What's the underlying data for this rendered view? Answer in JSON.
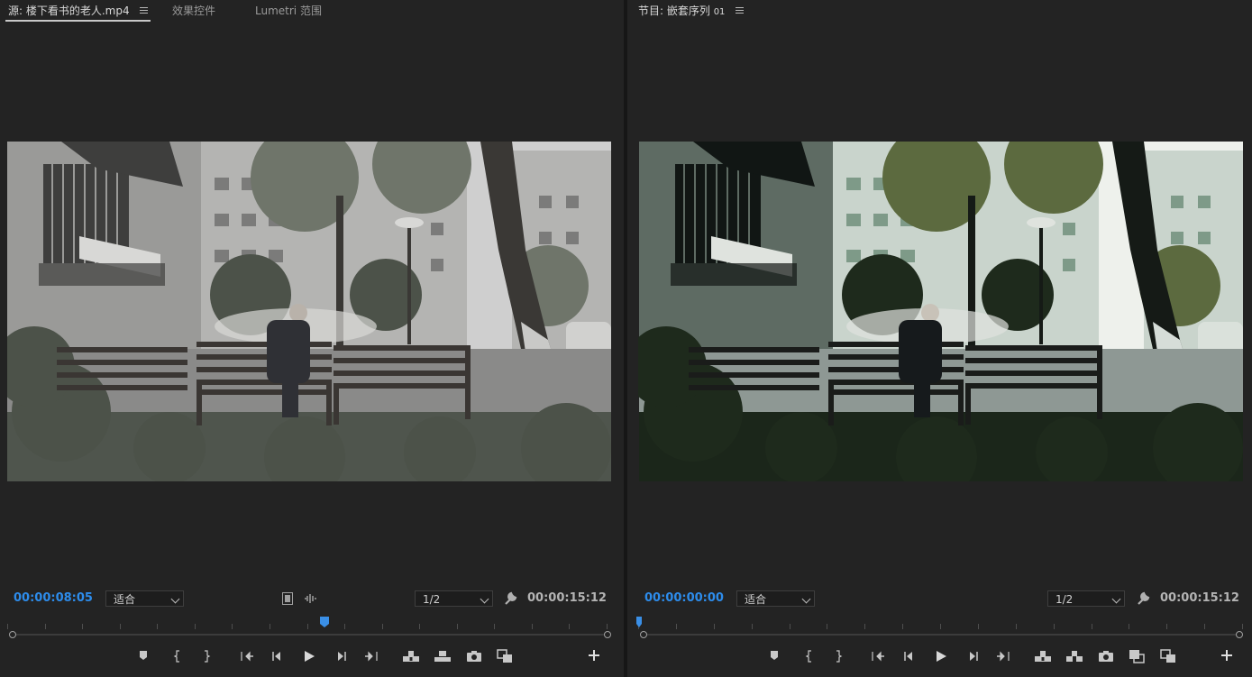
{
  "source_monitor": {
    "tabs": [
      {
        "label": "源: 楼下看书的老人.mp4",
        "active": true
      },
      {
        "label": "效果控件",
        "active": false
      },
      {
        "label": "Lumetri 范围",
        "active": false
      }
    ],
    "current_timecode": "00:00:08:05",
    "fit_dropdown": "适合",
    "resolution_dropdown": "1/2",
    "duration": "00:00:15:12",
    "playhead_position": 0.53,
    "image": "old-man-reading-on-bench-ungraded"
  },
  "program_monitor": {
    "title": "节目: 嵌套序列",
    "title_suffix": "01",
    "current_timecode": "00:00:00:00",
    "fit_dropdown": "适合",
    "resolution_dropdown": "1/2",
    "duration": "00:00:15:12",
    "playhead_position": 0.0,
    "image": "old-man-reading-on-bench-graded"
  },
  "icons": {
    "source_controls": [
      "add-marker-icon",
      "mark-in-icon",
      "mark-out-icon",
      "go-to-in-icon",
      "step-back-icon",
      "play-icon",
      "step-forward-icon",
      "go-to-out-icon",
      "insert-icon",
      "overwrite-icon",
      "export-frame-icon",
      "compare-icon",
      "button-editor-plus-icon"
    ],
    "program_controls": [
      "add-marker-icon",
      "mark-in-icon",
      "mark-out-icon",
      "go-to-in-icon",
      "step-back-icon",
      "play-icon",
      "step-forward-icon",
      "go-to-out-icon",
      "lift-icon",
      "extract-icon",
      "export-frame-icon",
      "comparison-view-icon",
      "compare-icon",
      "button-editor-plus-icon"
    ]
  },
  "colors": {
    "timecode_blue": "#2d8ceb",
    "playhead_blue": "#3a8fe6",
    "panel_bg": "#232323"
  }
}
